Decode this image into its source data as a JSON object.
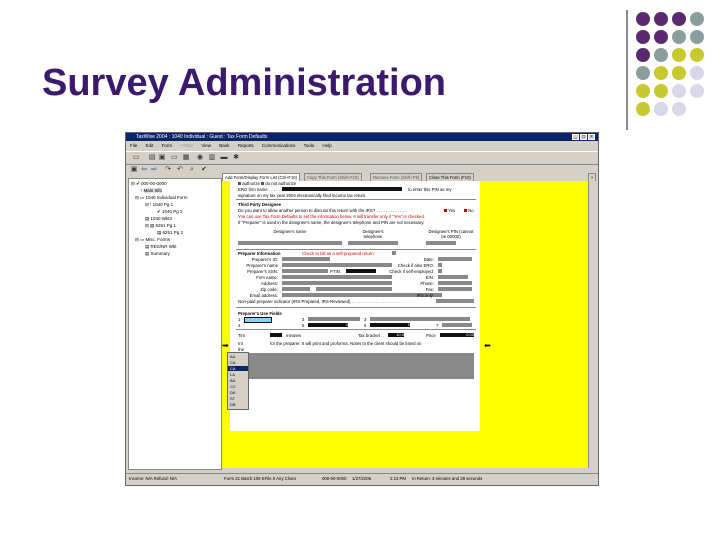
{
  "slide": {
    "title": "Survey Administration",
    "dot_colors": [
      "#5a2a6e",
      "#8a9ea0",
      "#c8c830",
      "#d8d8e8"
    ]
  },
  "window": {
    "title": "TaxWise 2004 : 1040 Individual : Guest : Tax Form Defaults",
    "menu": [
      "File",
      "Edit",
      "Form",
      "HTMV",
      "View",
      "Bank",
      "Reports",
      "Communications",
      "Tools",
      "Help"
    ],
    "tabs": [
      "Add Form/Display Form List (Ctrl+F10)",
      "Copy This Form (Shift+F10)",
      "Remove Form (Shift+F9)",
      "Close This Form (F10)"
    ]
  },
  "tree": {
    "items": [
      "000-00-0000",
      "Main Info",
      "1040 Individual Form",
      "1040 Pg 1",
      "1040 Pg 2",
      "1040 Wkt3",
      "6251 Pg 1",
      "6251 Pg 2",
      "Misc. Forms",
      "RES/NR Wkt",
      "Summary"
    ]
  },
  "form": {
    "authorize": "authorize",
    "not_authorize": "do not authorize",
    "ero_firm": "ERO firm name . . . . . .",
    "pin_text": "to enter this PIN as my",
    "sig_text": "signature on my tax year 2004 electronically filed income tax return.",
    "third_party_head": "Third Party Designee",
    "third_party_q": "Do you want to allow another person to discuss this return with the IRS? . . . . . . . . . . . . .",
    "yes": "Yes",
    "no": "No",
    "red_note1": "You can use Tax Form Defaults to set the information below.  It will transfer only if \"Yes\" is checked.",
    "red_note2": "If \"Preparer\" is used in the designee's name, the designee's telephone and PIN are not necessary.",
    "designee_name": "Designee's name",
    "designee_tel": "Designee's telephone",
    "designee_pin": "Designee's PIN (cannot be 00000)",
    "prep_head": "Preparer Information",
    "prep_check": "Check to bill as a self-prepared return:",
    "prep_id": "Preparer's ID:",
    "prep_name": "Preparer's name",
    "prep_ssn": "Preparer's SSN:",
    "ptin": "PTIN:",
    "firm_name": "Firm name:",
    "address": "Address:",
    "zip": "Zip code:",
    "email": "Email address:",
    "date": "Date:",
    "check_ero": "Check if also ERO:",
    "check_self": "Check if self-employed:",
    "ein": "EIN:",
    "phone": "Phone:",
    "fax": "Fax:",
    "irs_only": "IRS only:",
    "nonpaid": "Non-paid preparer indicator  (IRS-Prepared, IRS-Reviewed)  . . . . . . . . . . . . . . . . . . . . .",
    "use_fields_head": "Preparer's Use Fields",
    "row1_labels": [
      "1",
      "3",
      "3"
    ],
    "row2_labels": [
      "4",
      "5",
      "6",
      "7"
    ],
    "row2_vals": [
      "0",
      "0"
    ],
    "minutes_lbl": "Tim",
    "minutes": "minutes",
    "tax_bracket": "Tax bracket",
    "tax_bracket_val": "10.0",
    "price": "Price",
    "price_val": "0.00",
    "note_frag1": "Int",
    "note_frag2": "for the preparer.  It will print and proforma.  Notes to the client should be listed on",
    "note_frag3": "the",
    "dropdown": [
      "AA",
      "CA",
      "CA",
      "LA",
      "BA",
      "CC",
      "DA",
      "ST",
      "DB"
    ]
  },
  "status": {
    "s1": "Income: N/A Refund: N/A",
    "s2": "Form 21 Batch 109   EFile 0 Any Chars",
    "s3": "000-00-0000",
    "s4": "1/27/2006",
    "s5": "2:13 PM",
    "s6": "In Return: 3 minutes and 38 seconds"
  }
}
